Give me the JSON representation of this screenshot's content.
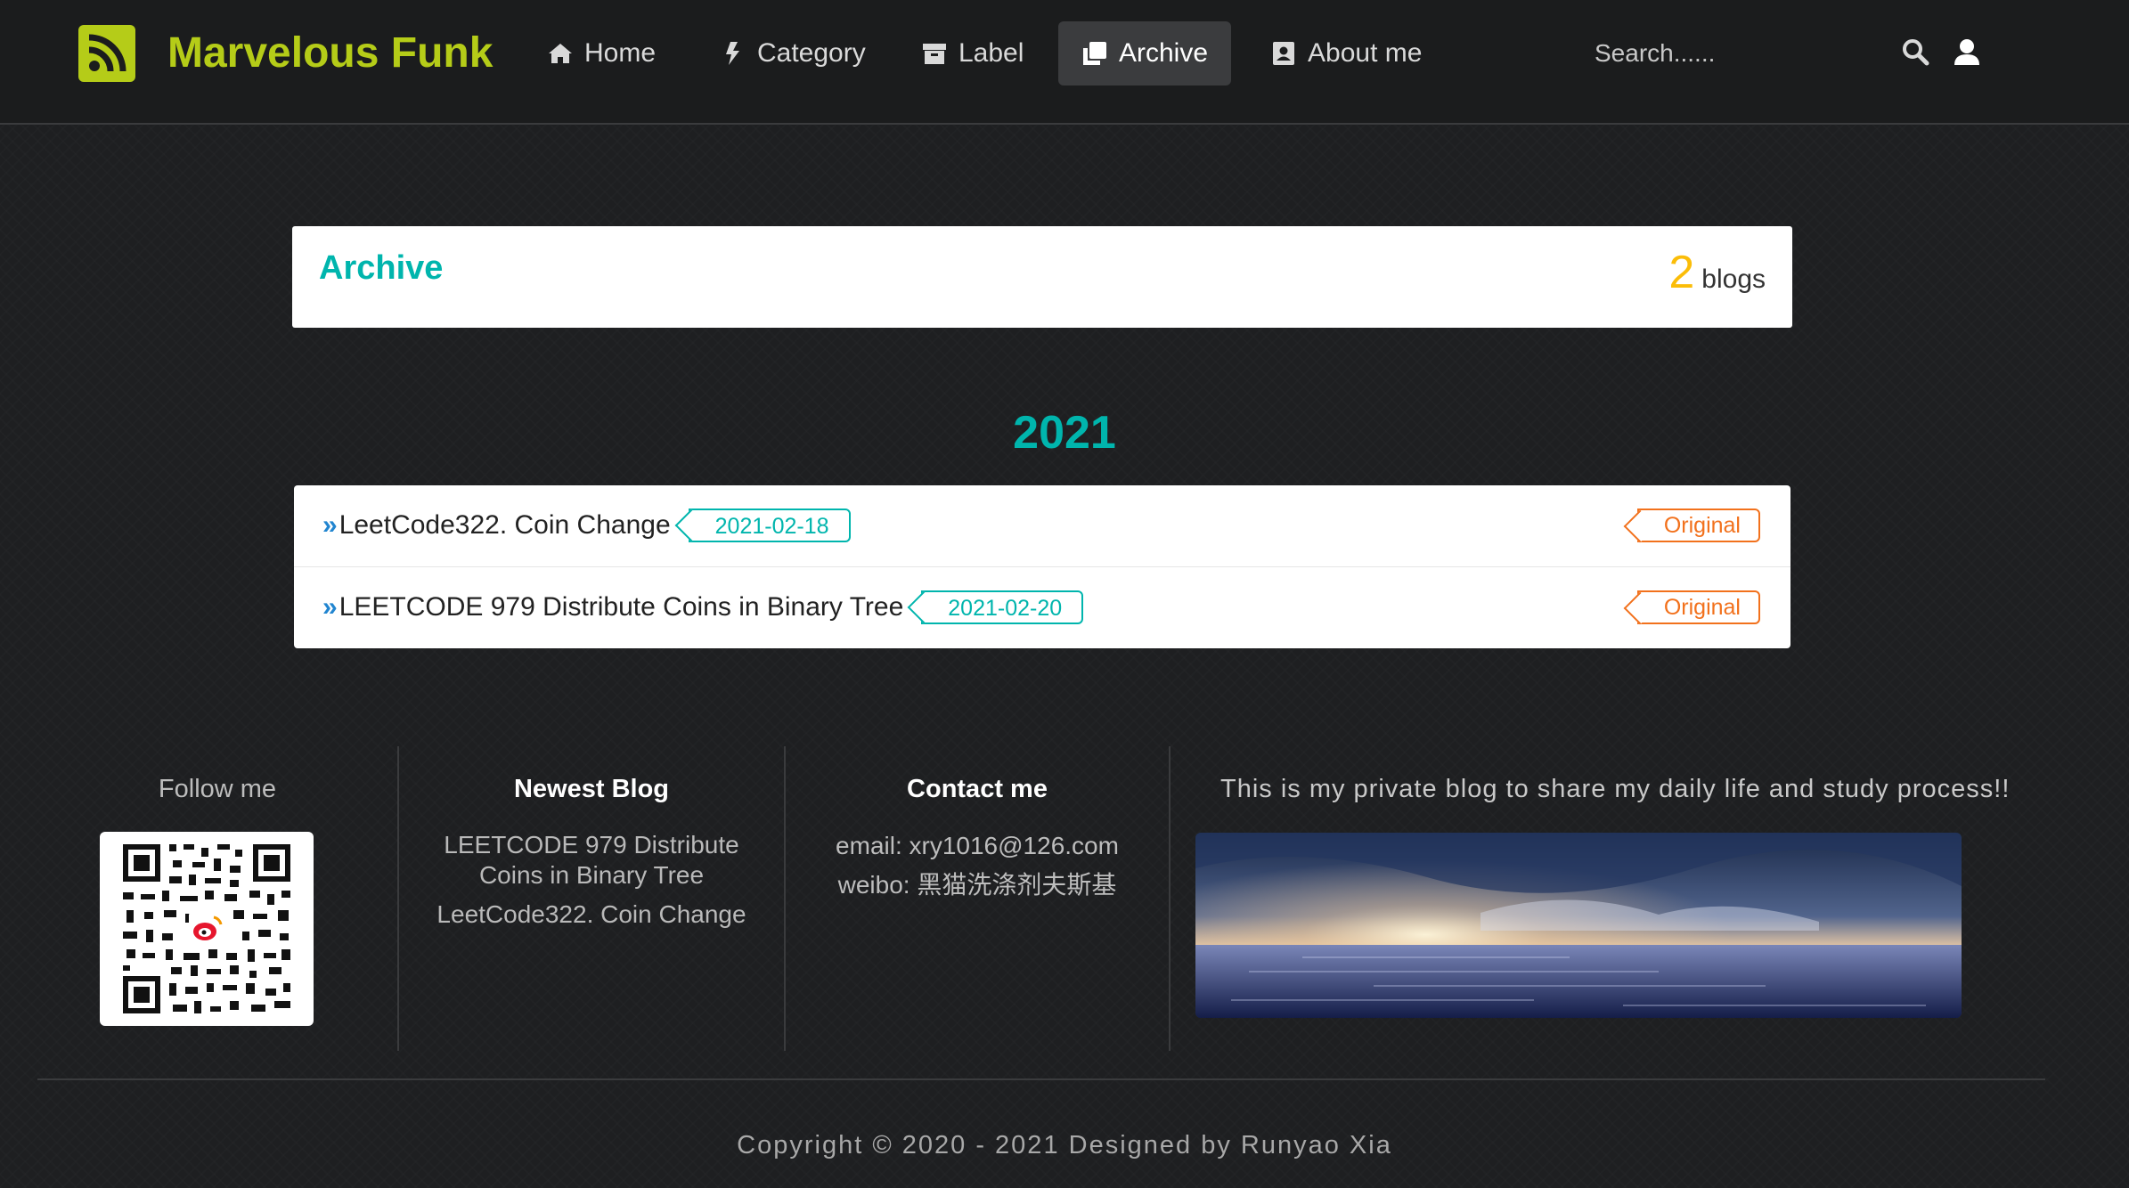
{
  "header": {
    "brand": "Marvelous Funk",
    "brand_color": "#b5cc18",
    "nav": [
      {
        "label": "Home",
        "icon": "home-icon",
        "active": false
      },
      {
        "label": "Category",
        "icon": "bolt-icon",
        "active": false
      },
      {
        "label": "Label",
        "icon": "archive-box-icon",
        "active": false
      },
      {
        "label": "Archive",
        "icon": "clone-icon",
        "active": true
      },
      {
        "label": "About me",
        "icon": "address-book-icon",
        "active": false
      }
    ],
    "search_placeholder": "Search......"
  },
  "archive": {
    "title": "Archive",
    "count": "2",
    "count_unit": "blogs"
  },
  "timeline": {
    "year": "2021",
    "posts": [
      {
        "title": "LeetCode322. Coin Change",
        "date": "2021-02-18",
        "type": "Original"
      },
      {
        "title": "LEETCODE 979 Distribute Coins in Binary Tree",
        "date": "2021-02-20",
        "type": "Original"
      }
    ],
    "chevron": "»"
  },
  "footer": {
    "follow_label": "Follow me",
    "newest_label": "Newest Blog",
    "newest_links": [
      "LEETCODE 979 Distribute Coins in Binary Tree",
      "LeetCode322. Coin Change"
    ],
    "contact_label": "Contact me",
    "email": "email: xry1016@126.com",
    "weibo": "weibo: 黑猫洗涤剂夫斯基",
    "blurb": "This is my private blog to share my daily life and study process!!",
    "copyright": "Copyright © 2020 - 2021 Designed by Runyao Xia"
  },
  "colors": {
    "accent_teal": "#00b5ad",
    "count_yellow": "#fbbd08",
    "original_orange": "#f2711c",
    "chevron_blue": "#2185d0"
  }
}
